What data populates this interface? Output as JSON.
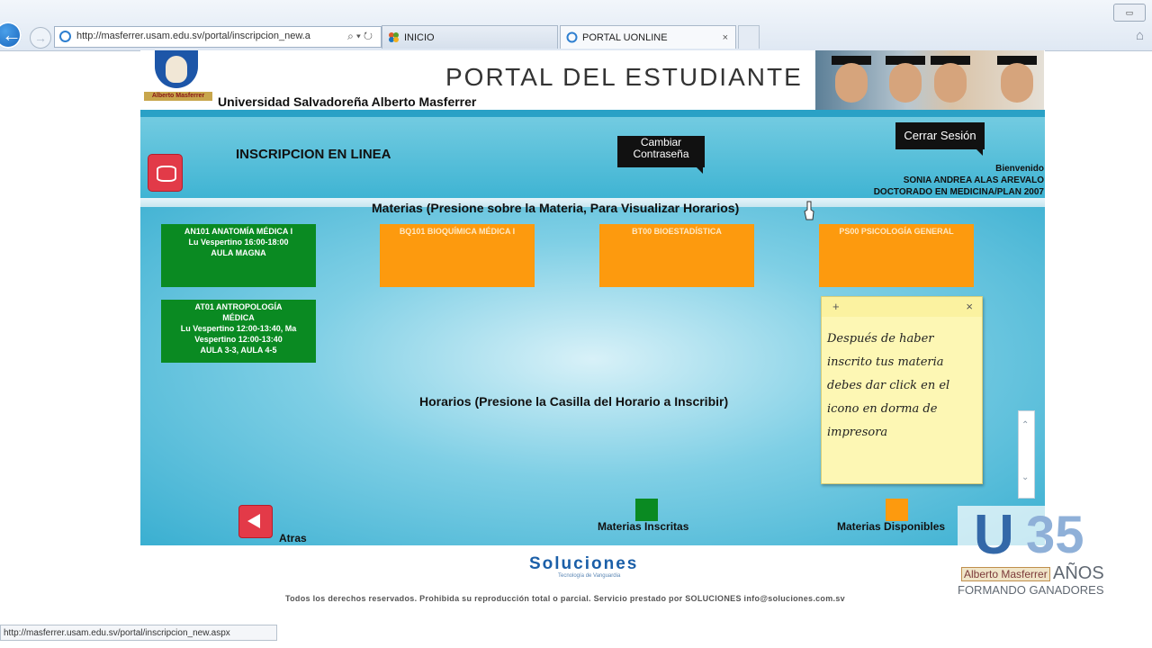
{
  "browser": {
    "address_url": "http://masferrer.usam.edu.sv/portal/inscripcion_new.a",
    "tabs": [
      {
        "label": "INICIO"
      },
      {
        "label": "PORTAL UONLINE"
      }
    ],
    "status_url": "http://masferrer.usam.edu.sv/portal/inscripcion_new.aspx"
  },
  "header": {
    "logo_text": "Alberto Masferrer",
    "university": "Universidad Salvadoreña Alberto Masferrer",
    "portal_title": "PORTAL DEL ESTUDIANTE"
  },
  "top_panel": {
    "title": "INSCRIPCION EN LINEA",
    "change_password": "Cambiar Contraseña",
    "logout": "Cerrar Sesión",
    "welcome": "Bienvenido",
    "student_name": "SONIA ANDREA ALAS AREVALO",
    "program": "DOCTORADO EN MEDICINA/PLAN 2007"
  },
  "main": {
    "materias_title": "Materias (Presione sobre la Materia, Para Visualizar Horarios)",
    "courses": [
      {
        "line1": "AN101 ANATOMÍA MÉDICA I",
        "line2": "Lu Vespertino 16:00-18:00",
        "line3": "AULA MAGNA",
        "line4": "",
        "line5": "",
        "status": "inscrita"
      },
      {
        "line1": "BQ101 BIOQUÍMICA MÉDICA I",
        "line2": "",
        "line3": "",
        "line4": "",
        "line5": "",
        "status": "disponible"
      },
      {
        "line1": "BT00 BIOESTADÍSTICA",
        "line2": "",
        "line3": "",
        "line4": "",
        "line5": "",
        "status": "disponible"
      },
      {
        "line1": "PS00 PSICOLOGÍA GENERAL",
        "line2": "",
        "line3": "",
        "line4": "",
        "line5": "",
        "status": "disponible"
      },
      {
        "line1": "AT01 ANTROPOLOGÍA",
        "line2": "MÉDICA",
        "line3": "Lu Vespertino 12:00-13:40, Ma",
        "line4": "Vespertino 12:00-13:40",
        "line5": "AULA 3-3, AULA 4-5",
        "status": "inscrita"
      }
    ],
    "horarios_title": "Horarios (Presione la Casilla del Horario a Inscribir)",
    "atras": "Atras",
    "legend_inscritas": "Materias Inscritas",
    "legend_disponibles": "Materias Disponibles"
  },
  "sticky_note": {
    "plus": "+",
    "close": "×",
    "lines": [
      "Después de haber",
      "inscrito tus materia",
      "debes dar click en el",
      "icono en dorma de",
      "impresora"
    ]
  },
  "footer": {
    "logo": "Soluciones",
    "logo_sub": "Tecnología de Vanguardia",
    "copyright": "Todos los derechos reservados. Prohibida su reproducción total o parcial. Servicio prestado por SOLUCIONES info@soluciones.com.sv"
  },
  "watermark": {
    "u": "U",
    "num": "35",
    "name": "Alberto Masferrer",
    "anos": "AÑOS",
    "slogan": "FORMANDO GANADORES"
  },
  "colors": {
    "inscrita": "#0a8a22",
    "disponible": "#fd9a0e",
    "panel": "#3fb4d3",
    "accent_red": "#e33a48"
  }
}
